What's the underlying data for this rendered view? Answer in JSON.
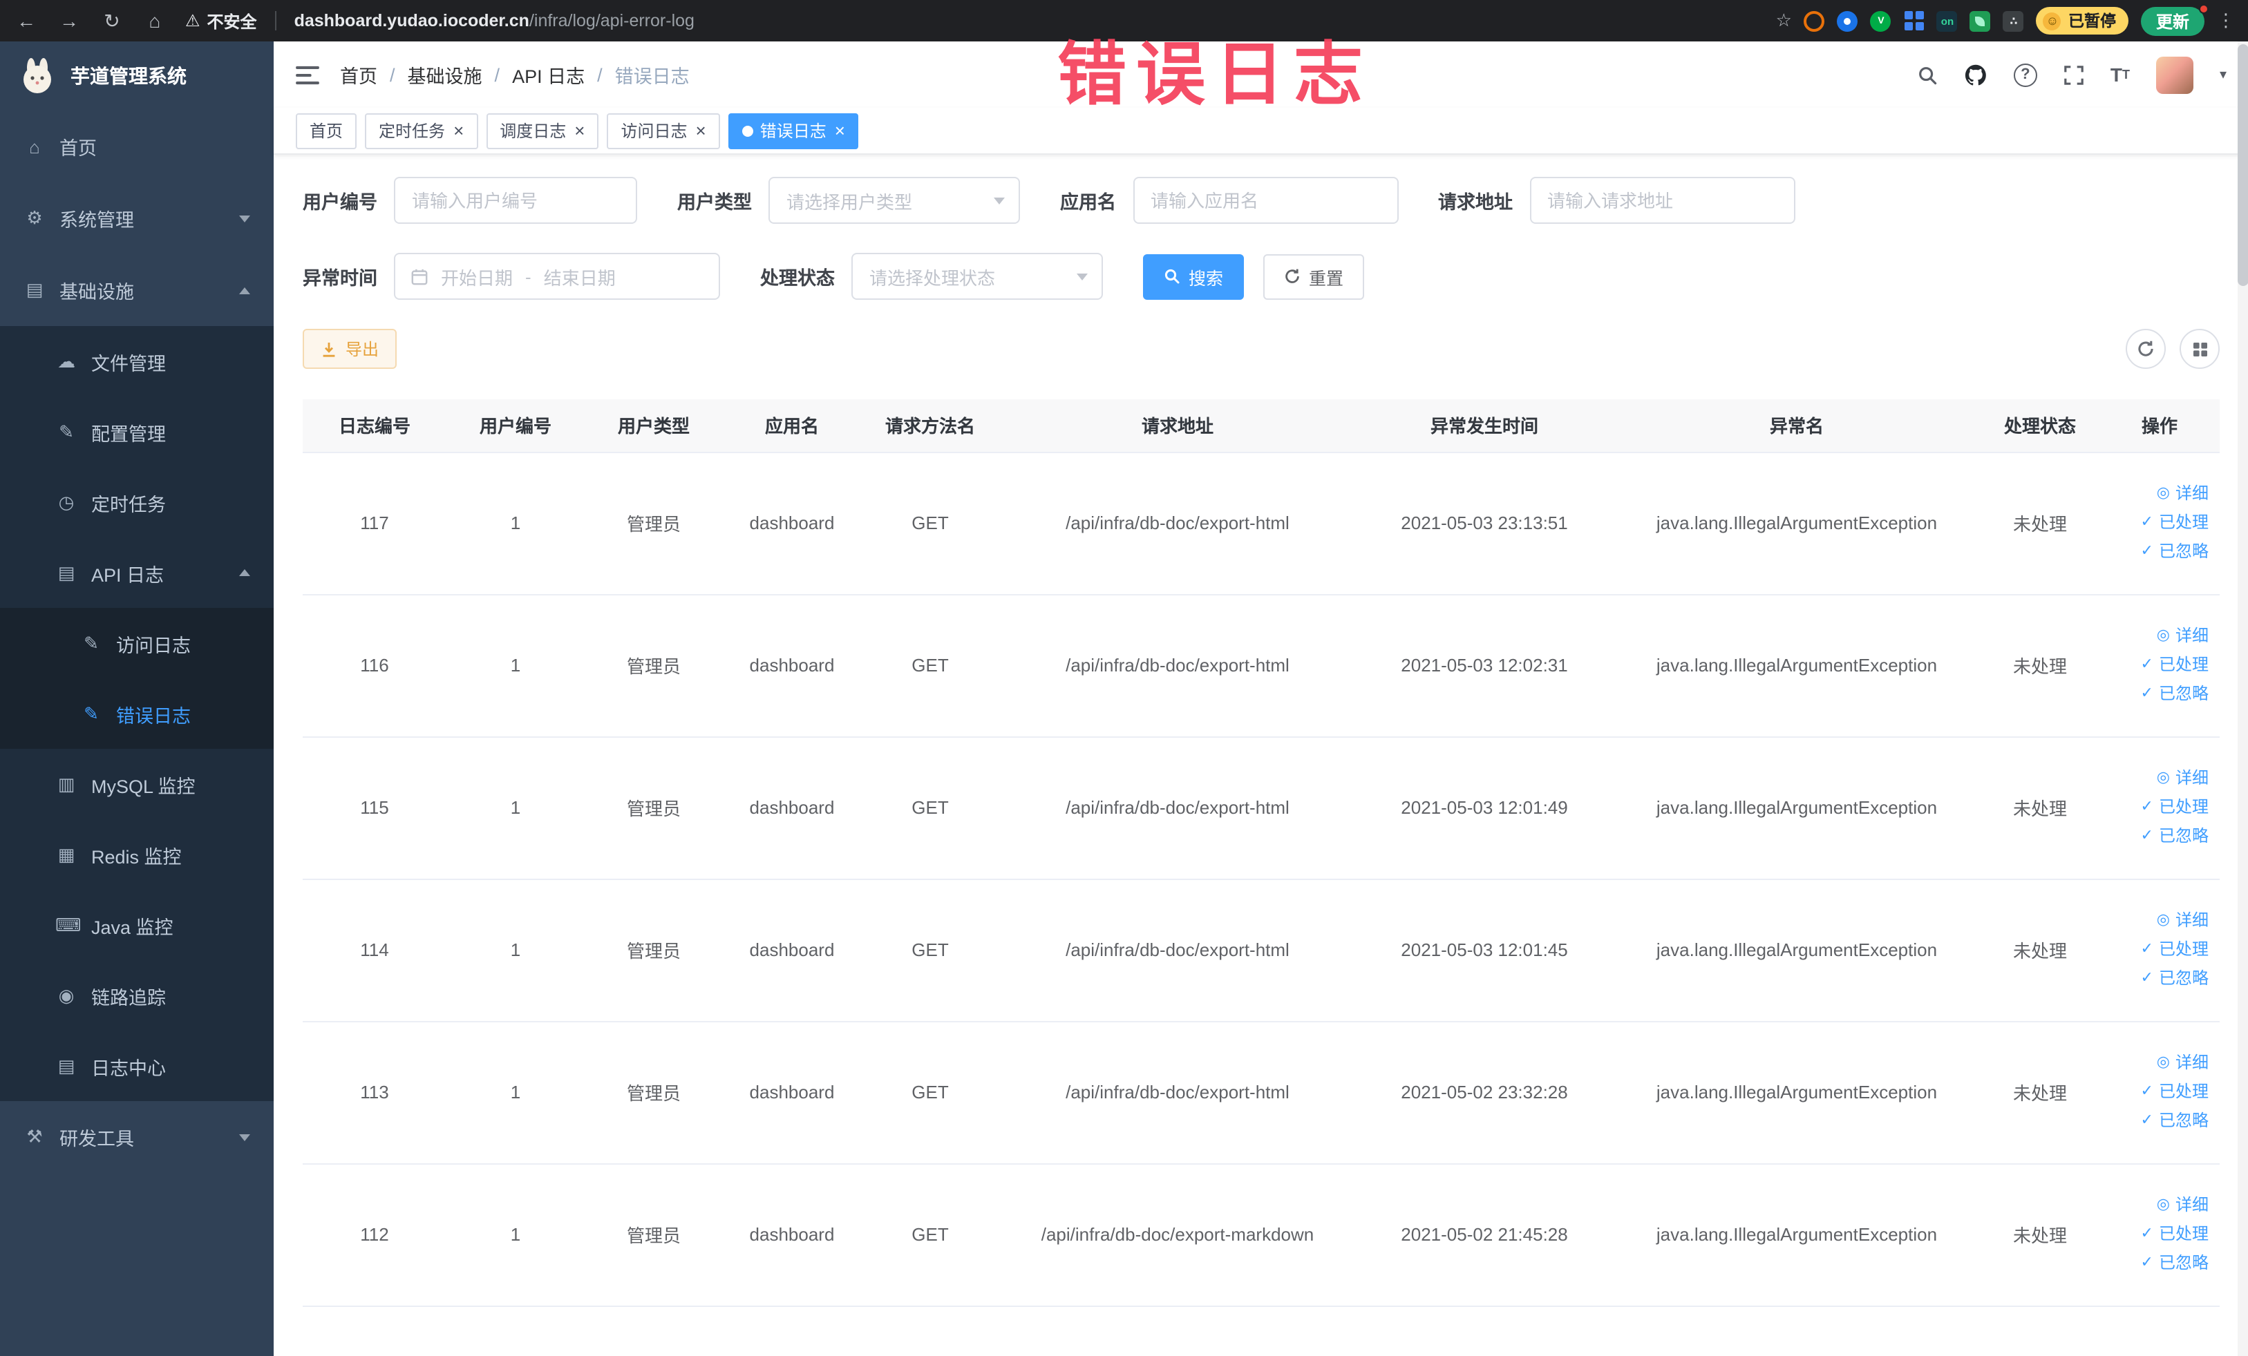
{
  "browser": {
    "security_label": "不安全",
    "url_host": "dashboard.yudao.iocoder.cn",
    "url_path": "/infra/log/api-error-log",
    "on_badge": "on",
    "paused_badge": "已暂停",
    "update_label": "更新"
  },
  "watermark": "错误日志",
  "sidebar": {
    "app_title": "芋道管理系统",
    "items": [
      {
        "key": "home",
        "label": "首页",
        "icon": "home-icon",
        "level": 1
      },
      {
        "key": "system-management",
        "label": "系统管理",
        "icon": "gear-icon",
        "level": 1,
        "expandable": true,
        "expanded": false
      },
      {
        "key": "infrastructure",
        "label": "基础设施",
        "icon": "infrastructure-icon",
        "level": 1,
        "expandable": true,
        "expanded": true
      },
      {
        "key": "file-management",
        "label": "文件管理",
        "icon": "file-manage-icon",
        "level": 2
      },
      {
        "key": "config-management",
        "label": "配置管理",
        "icon": "config-manage-icon",
        "level": 2
      },
      {
        "key": "scheduled-tasks",
        "label": "定时任务",
        "icon": "scheduled-task-icon",
        "level": 2
      },
      {
        "key": "api-logs",
        "label": "API 日志",
        "icon": "api-log-icon",
        "level": 2,
        "expandable": true,
        "expanded": true
      },
      {
        "key": "access-log",
        "label": "访问日志",
        "icon": "access-log-icon",
        "level": 3
      },
      {
        "key": "error-log",
        "label": "错误日志",
        "icon": "error-log-icon",
        "level": 3,
        "active": true
      },
      {
        "key": "mysql-monitor",
        "label": "MySQL 监控",
        "icon": "mysql-monitor-icon",
        "level": 2
      },
      {
        "key": "redis-monitor",
        "label": "Redis 监控",
        "icon": "redis-monitor-icon",
        "level": 2
      },
      {
        "key": "java-monitor",
        "label": "Java 监控",
        "icon": "java-monitor-icon",
        "level": 2
      },
      {
        "key": "link-trace",
        "label": "链路追踪",
        "icon": "trace-icon",
        "level": 2
      },
      {
        "key": "log-center",
        "label": "日志中心",
        "icon": "log-center-icon",
        "level": 2
      },
      {
        "key": "dev-tools",
        "label": "研发工具",
        "icon": "dev-tools-icon",
        "level": 1,
        "expandable": true,
        "expanded": false
      }
    ]
  },
  "breadcrumb": [
    "首页",
    "基础设施",
    "API 日志",
    "错误日志"
  ],
  "tabs": [
    {
      "key": "home",
      "label": "首页",
      "closable": false,
      "active": false
    },
    {
      "key": "scheduled-tasks",
      "label": "定时任务",
      "closable": true,
      "active": false
    },
    {
      "key": "schedule-log",
      "label": "调度日志",
      "closable": true,
      "active": false
    },
    {
      "key": "access-log",
      "label": "访问日志",
      "closable": true,
      "active": false
    },
    {
      "key": "error-log",
      "label": "错误日志",
      "closable": true,
      "active": true
    }
  ],
  "filters": {
    "user_id": {
      "label": "用户编号",
      "placeholder": "请输入用户编号"
    },
    "user_type": {
      "label": "用户类型",
      "placeholder": "请选择用户类型"
    },
    "app_name": {
      "label": "应用名",
      "placeholder": "请输入应用名"
    },
    "request_url": {
      "label": "请求地址",
      "placeholder": "请输入请求地址"
    },
    "exception_time": {
      "label": "异常时间",
      "start_placeholder": "开始日期",
      "separator": "-",
      "end_placeholder": "结束日期"
    },
    "process_status": {
      "label": "处理状态",
      "placeholder": "请选择处理状态"
    },
    "search_label": "搜索",
    "reset_label": "重置"
  },
  "toolbar": {
    "export_label": "导出"
  },
  "table": {
    "columns": [
      "日志编号",
      "用户编号",
      "用户类型",
      "应用名",
      "请求方法名",
      "请求地址",
      "异常发生时间",
      "异常名",
      "处理状态",
      "操作"
    ],
    "actions": [
      "详细",
      "已处理",
      "已忽略"
    ],
    "rows": [
      [
        "117",
        "1",
        "管理员",
        "dashboard",
        "GET",
        "/api/infra/db-doc/export-html",
        "2021-05-03 23:13:51",
        "java.lang.IllegalArgumentException",
        "未处理"
      ],
      [
        "116",
        "1",
        "管理员",
        "dashboard",
        "GET",
        "/api/infra/db-doc/export-html",
        "2021-05-03 12:02:31",
        "java.lang.IllegalArgumentException",
        "未处理"
      ],
      [
        "115",
        "1",
        "管理员",
        "dashboard",
        "GET",
        "/api/infra/db-doc/export-html",
        "2021-05-03 12:01:49",
        "java.lang.IllegalArgumentException",
        "未处理"
      ],
      [
        "114",
        "1",
        "管理员",
        "dashboard",
        "GET",
        "/api/infra/db-doc/export-html",
        "2021-05-03 12:01:45",
        "java.lang.IllegalArgumentException",
        "未处理"
      ],
      [
        "113",
        "1",
        "管理员",
        "dashboard",
        "GET",
        "/api/infra/db-doc/export-html",
        "2021-05-02 23:32:28",
        "java.lang.IllegalArgumentException",
        "未处理"
      ],
      [
        "112",
        "1",
        "管理员",
        "dashboard",
        "GET",
        "/api/infra/db-doc/export-markdown",
        "2021-05-02 21:45:28",
        "java.lang.IllegalArgumentException",
        "未处理"
      ]
    ]
  },
  "colors": {
    "primary": "#409eff",
    "watermark_red": "#f5455f",
    "warning": "#e6a23c",
    "sidebar_bg": "#304156",
    "chrome_bg": "#202124"
  }
}
